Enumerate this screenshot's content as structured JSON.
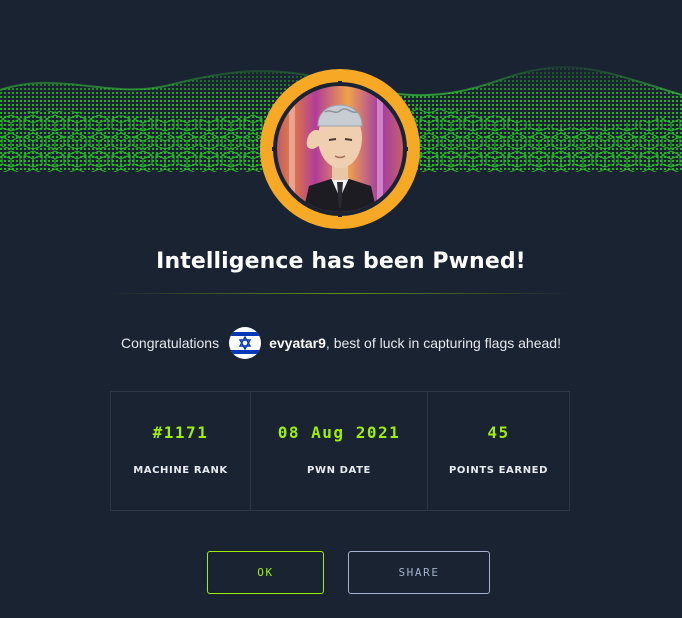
{
  "modal": {
    "title": "Intelligence has been Pwned!"
  },
  "congrats": {
    "prefix": "Congratulations",
    "flag_icon": "israel-flag-icon",
    "username": "evyatar9",
    "suffix": ", best of luck in capturing flags ahead!"
  },
  "stats": [
    {
      "value": "#1171",
      "label": "MACHINE RANK"
    },
    {
      "value": "08 Aug 2021",
      "label": "PWN DATE"
    },
    {
      "value": "45",
      "label": "POINTS EARNED"
    }
  ],
  "buttons": {
    "ok_label": "OK",
    "share_label": "SHARE"
  },
  "colors": {
    "background": "#1a2332",
    "accent": "#9fef00",
    "avatar_ring": "#f7a824",
    "share_border": "#a4b1cd"
  },
  "icons": {
    "banner": "green-hex-grid-wave",
    "avatar": "machine-avatar-icon"
  }
}
